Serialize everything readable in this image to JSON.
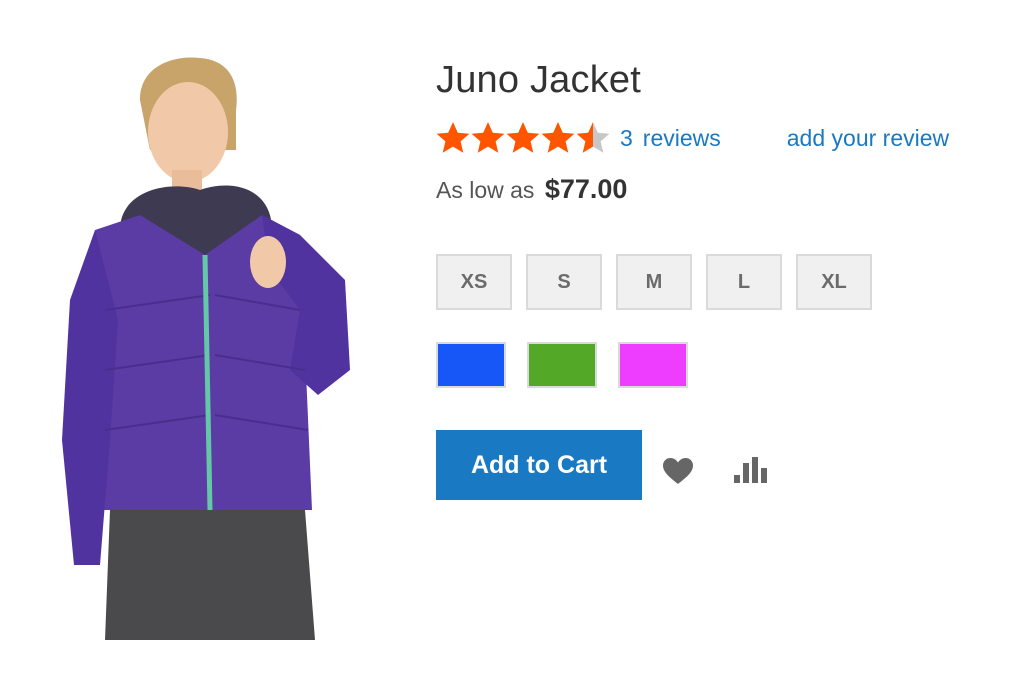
{
  "product": {
    "title": "Juno Jacket",
    "rating": 4.5,
    "rating_max": 5,
    "review_count": "3",
    "reviews_label": "reviews",
    "add_review_label": "add your review",
    "price_prefix": "As low as",
    "price": "$77.00",
    "image_icon": "product-photo-woman-purple-jacket"
  },
  "sizes": [
    "XS",
    "S",
    "M",
    "L",
    "XL"
  ],
  "colors": [
    {
      "name": "blue",
      "hex": "#1857f7"
    },
    {
      "name": "green",
      "hex": "#53a828"
    },
    {
      "name": "purple",
      "hex": "#ef3dff"
    }
  ],
  "actions": {
    "add_to_cart_label": "Add to Cart",
    "wishlist_icon": "heart-icon",
    "compare_icon": "compare-bars-icon"
  },
  "theme": {
    "accent": "#1979c3",
    "star_color": "#ff5501",
    "star_empty_color": "#c7c7c7"
  }
}
